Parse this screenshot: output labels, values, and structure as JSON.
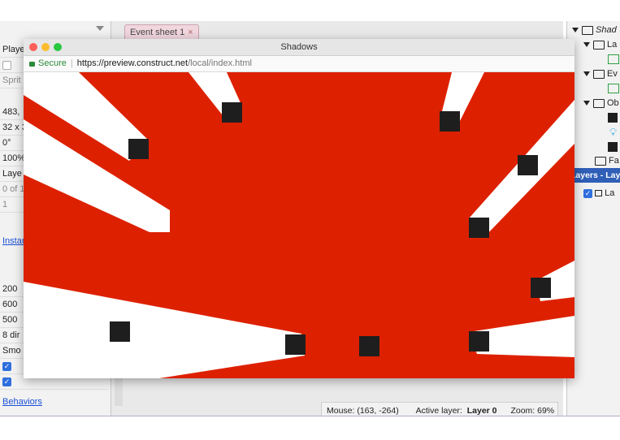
{
  "editor": {
    "tab_label": "Event sheet 1",
    "tab_close": "×",
    "left_panel": {
      "rows": [
        "Playe",
        "",
        "Sprit",
        "483,",
        "32 x 3",
        "0°",
        "100%",
        "Laye",
        "0 of 1",
        "1",
        "Instan",
        "200",
        "600",
        "500",
        "8 dir",
        "Smo",
        "",
        "",
        "Behaviors"
      ]
    },
    "status": {
      "mouse": "Mouse: (163, -264)",
      "active_layer_label": "Active layer:",
      "active_layer_value": "Layer 0",
      "zoom": "Zoom: 69%"
    },
    "project_panel": {
      "root": "Shad",
      "items": [
        "La",
        "Ev",
        "Ob",
        "Fa"
      ],
      "layers_header": "Layers - Layo",
      "layer_row": "La"
    }
  },
  "browser": {
    "title": "Shadows",
    "secure_label": "Secure",
    "url_host": "https://preview.construct.net",
    "url_path": "/local/index.html"
  },
  "colors": {
    "canvas_background": "#dd2100",
    "shadow_light": "#ffffff",
    "block": "#1e1e1e",
    "layers_header": "#2f5fb7"
  }
}
